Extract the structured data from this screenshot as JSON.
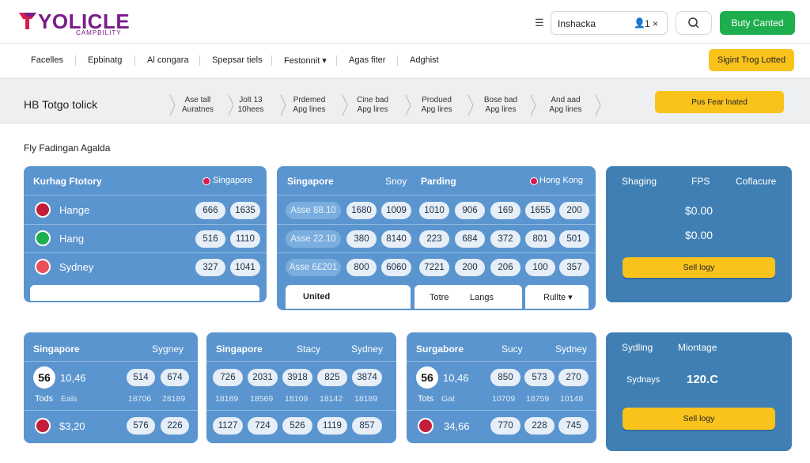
{
  "header": {
    "logo_text": "YOLICLE",
    "logo_sub": "CAMPBILITY",
    "search_value": "Inshacka",
    "search_count": "1 ×",
    "primary_button": "Buty Canted"
  },
  "nav": {
    "items": [
      "Facelles",
      "Epbinatg",
      "Al congara",
      "Spepsar tiels",
      "Festonnit ▾",
      "Agas fiter",
      "Adghist"
    ],
    "action_button": "Sigint Trog Lotted"
  },
  "band": {
    "title": "HB  Totgo tolick",
    "columns": [
      [
        "Ase tall",
        "Auratnes"
      ],
      [
        "Jolt 13",
        "10hees"
      ],
      [
        "Prdemed",
        "Apg lines"
      ],
      [
        "Cine bad",
        "Apg lires"
      ],
      [
        "Produed",
        "Apg lires"
      ],
      [
        "Bose bad",
        "Apg lires"
      ],
      [
        "And aad",
        "Apg lines"
      ]
    ],
    "button": "Pus Fear lnated"
  },
  "section_title": "Fly Fadingan Agalda",
  "panel1": {
    "title": "Kurhag Ftotory",
    "location": "Singapore",
    "rows": [
      {
        "label": "Hange",
        "values": [
          "666",
          "1635"
        ]
      },
      {
        "label": "Hang",
        "values": [
          "516",
          "1110"
        ]
      },
      {
        "label": "Sydney",
        "values": [
          "327",
          "1041"
        ]
      }
    ]
  },
  "panel2": {
    "col1": "Singapore",
    "col2": "Snoy",
    "col3": "Parding",
    "location": "Hong Kong",
    "rows": [
      {
        "label": "Asse 88.10",
        "values": [
          "1680",
          "1009",
          "1010",
          "906",
          "169",
          "1655",
          "200"
        ]
      },
      {
        "label": "Asse 22.10",
        "values": [
          "380",
          "8140",
          "223",
          "684",
          "372",
          "801",
          "501"
        ]
      },
      {
        "label": "Asse 6£201",
        "values": [
          "800",
          "6060",
          "7221",
          "200",
          "206",
          "100",
          "357"
        ]
      }
    ],
    "tabs": [
      "United",
      "Totre",
      "Langs",
      "Rullte ▾"
    ]
  },
  "panel3": {
    "headers": [
      "Shaging",
      "FPS",
      "Coflacure"
    ],
    "values": [
      "$0.00",
      "$0.00"
    ],
    "button": "Sell logy"
  },
  "panel4": {
    "col1": "Singapore",
    "col2": "Sygney",
    "circle": "56",
    "row1": {
      "label": "10,46",
      "values": [
        "514",
        "674"
      ]
    },
    "row2": {
      "label": "Tods",
      "sub": "Eals",
      "values": [
        "18706",
        "28189"
      ]
    },
    "row3": {
      "label": "$3,20",
      "values": [
        "576",
        "226"
      ]
    }
  },
  "panel5": {
    "col1": "Singapore",
    "col2": "Stacy",
    "col3": "Sydney",
    "rows": [
      [
        "726",
        "2031",
        "3918",
        "825",
        "3874"
      ],
      [
        "18189",
        "18569",
        "18109",
        "18142",
        "18189"
      ],
      [
        "1127",
        "724",
        "526",
        "1119",
        "857"
      ]
    ]
  },
  "panel6": {
    "col1": "Surgabore",
    "col2": "Sucy",
    "col3": "Sydney",
    "circle": "56",
    "row1": {
      "label": "10,46",
      "values": [
        "850",
        "573",
        "270"
      ]
    },
    "row2": {
      "label": "Tots",
      "sub": "Gat",
      "values": [
        "10709",
        "18759",
        "10148"
      ]
    },
    "row3": {
      "label": "34,66",
      "values": [
        "770",
        "228",
        "745"
      ]
    }
  },
  "panel7": {
    "col1": "Sydling",
    "col2": "Miontage",
    "label": "Sydnays",
    "value": "120.C",
    "button": "Sell logy"
  }
}
